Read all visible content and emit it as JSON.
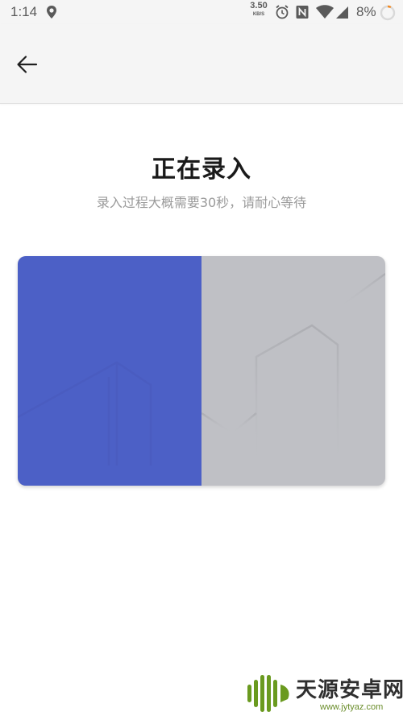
{
  "status_bar": {
    "time": "1:14",
    "network_speed_value": "3.50",
    "network_speed_unit": "KB/S",
    "battery_percent": "8%",
    "icons": [
      "location-icon",
      "alarm-icon",
      "nfc-icon",
      "wifi-icon",
      "signal-icon",
      "battery-ring-icon"
    ]
  },
  "header": {
    "back_icon": "arrow-left-icon"
  },
  "main": {
    "title": "正在录入",
    "subtitle": "录入过程大概需要30秒，请耐心等待"
  },
  "progress": {
    "fraction": 0.5,
    "fill_color": "#4c60c6",
    "track_color": "#bfc0c5"
  },
  "watermark": {
    "text": "天源安卓网",
    "url": "www.jytyaz.com",
    "logo_color": "#6a9a1f"
  }
}
